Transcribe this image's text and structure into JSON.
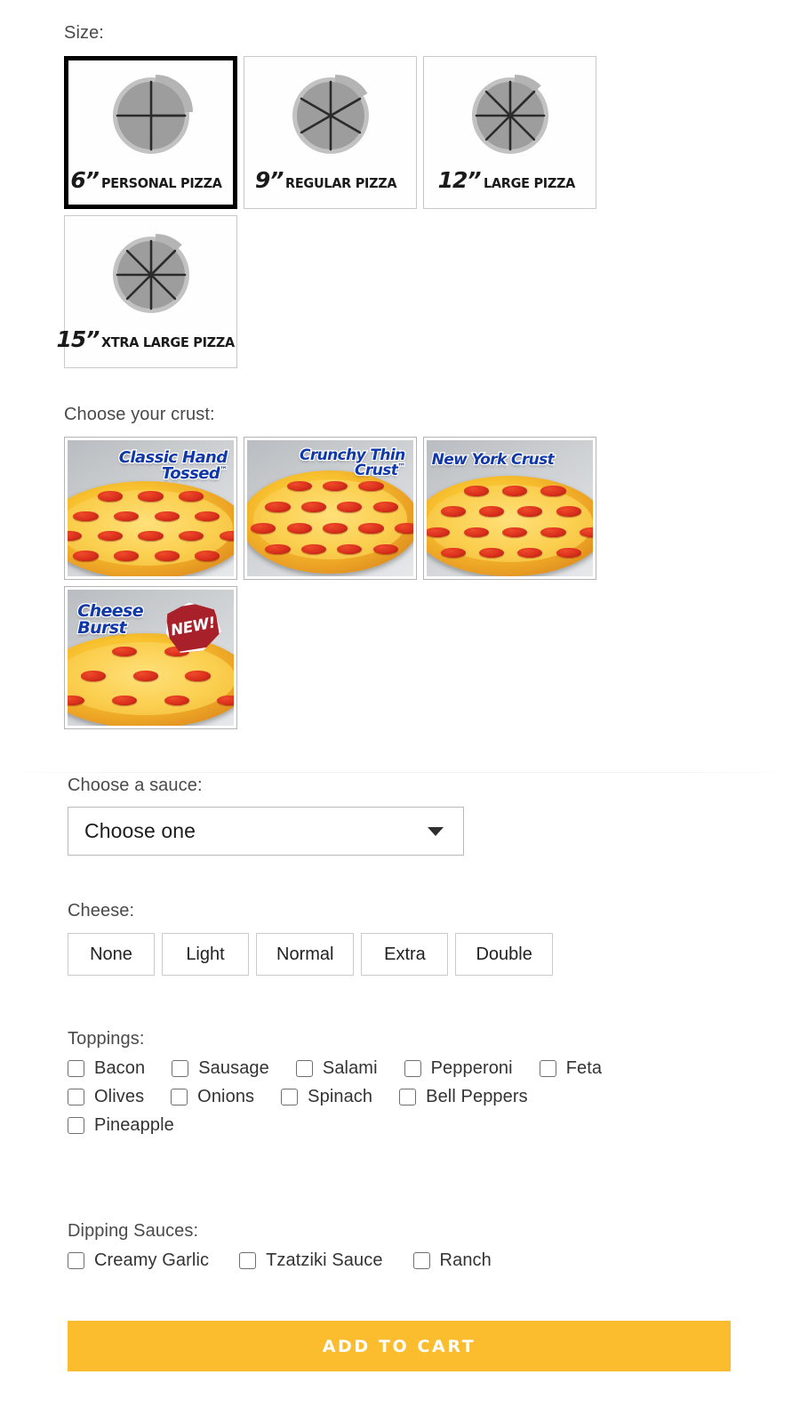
{
  "size": {
    "label": "Size:",
    "options": [
      {
        "inches": "6”",
        "name": "PERSONAL PIZZA",
        "slices": 4,
        "selected": true
      },
      {
        "inches": "9”",
        "name": "REGULAR PIZZA",
        "slices": 6,
        "selected": false
      },
      {
        "inches": "12”",
        "name": "LARGE PIZZA",
        "slices": 8,
        "selected": false
      },
      {
        "inches": "15”",
        "name": "XTRA LARGE PIZZA",
        "slices": 8,
        "selected": false
      }
    ]
  },
  "crust": {
    "label": "Choose your crust:",
    "options": [
      {
        "name": "Classic Hand Tossed",
        "line1": "Classic Hand",
        "line2": "Tossed",
        "tm": "™",
        "badge": ""
      },
      {
        "name": "Crunchy Thin Crust",
        "line1": "Crunchy Thin",
        "line2": "Crust",
        "tm": "™",
        "badge": ""
      },
      {
        "name": "New York Crust",
        "line1": "New York Crust",
        "line2": "",
        "tm": "",
        "badge": ""
      },
      {
        "name": "Cheese Burst",
        "line1": "Cheese",
        "line2": "Burst",
        "tm": "",
        "badge": "NEW!"
      }
    ]
  },
  "sauce": {
    "label": "Choose a sauce:",
    "selected": "Choose one",
    "placeholder": "Choose one"
  },
  "cheese": {
    "label": "Cheese:",
    "options": [
      "None",
      "Light",
      "Normal",
      "Extra",
      "Double"
    ]
  },
  "toppings": {
    "label": "Toppings:",
    "rows": [
      [
        "Bacon",
        "Sausage",
        "Salami",
        "Pepperoni",
        "Feta"
      ],
      [
        "Olives",
        "Onions",
        "Spinach",
        "Bell Peppers"
      ],
      [
        "Pineapple"
      ]
    ]
  },
  "dipping": {
    "label": "Dipping Sauces:",
    "rows": [
      [
        "Creamy Garlic",
        "Tzatziki Sauce",
        "Ranch"
      ]
    ]
  },
  "cart": {
    "label": "ADD TO CART",
    "color": "#fbbc2e"
  }
}
